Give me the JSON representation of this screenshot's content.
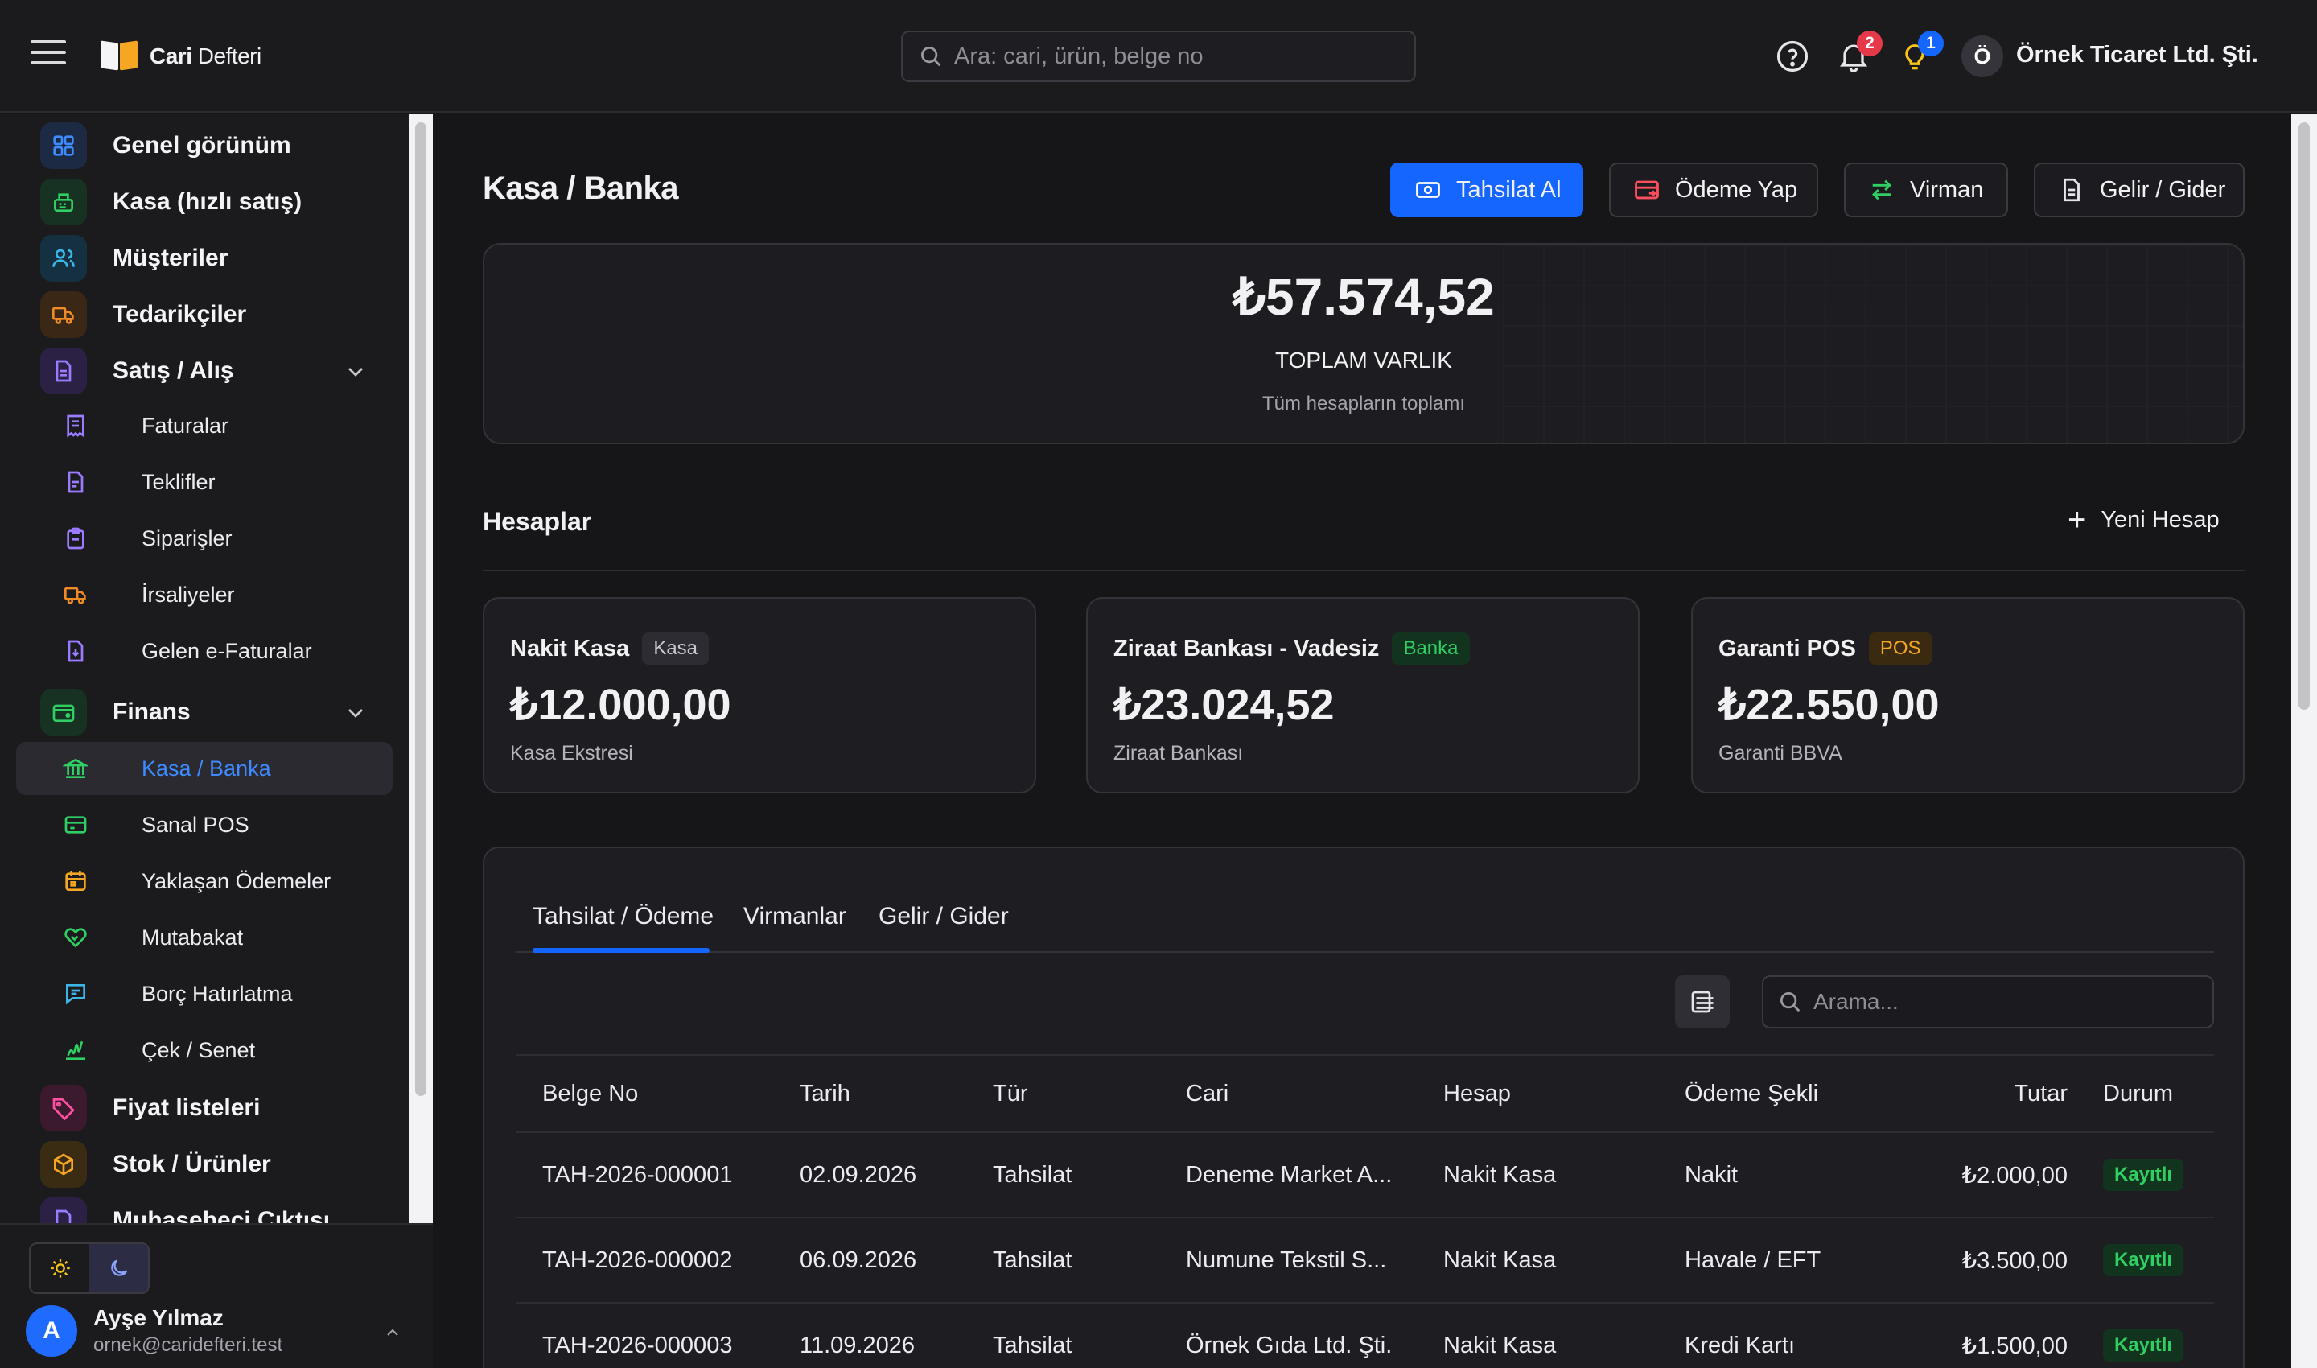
{
  "app": {
    "brand_bold": "Cari",
    "brand_rest": " Defteri"
  },
  "topbar": {
    "search_placeholder": "Ara: cari, ürün, belge no",
    "notifications_count": "2",
    "tips_count": "1",
    "company_initial": "Ö",
    "company_name": "Örnek Ticaret Ltd. Şti."
  },
  "sidebar": {
    "main": [
      {
        "label": "Genel görünüm",
        "icon": "grid-icon",
        "color": "#3d8bff"
      },
      {
        "label": "Kasa (hızlı satış)",
        "icon": "cash-register-icon",
        "color": "#2fcf63"
      },
      {
        "label": "Müşteriler",
        "icon": "users-icon",
        "color": "#3db5e8"
      },
      {
        "label": "Tedarikçiler",
        "icon": "truck-icon",
        "color": "#f08a24"
      },
      {
        "label": "Satış / Alış",
        "icon": "document-icon",
        "color": "#9b7bff"
      }
    ],
    "sales_sub": [
      {
        "label": "Faturalar",
        "icon": "receipt-icon",
        "color": "#9b7bff"
      },
      {
        "label": "Teklifler",
        "icon": "file-icon",
        "color": "#9b7bff"
      },
      {
        "label": "Siparişler",
        "icon": "clipboard-icon",
        "color": "#9b7bff"
      },
      {
        "label": "İrsaliyeler",
        "icon": "truck-icon",
        "color": "#f08a24"
      },
      {
        "label": "Gelen e-Faturalar",
        "icon": "file-download-icon",
        "color": "#9b7bff"
      }
    ],
    "finance": {
      "label": "Finans",
      "icon": "wallet-icon",
      "color": "#2fcf63"
    },
    "finance_sub": [
      {
        "label": "Kasa / Banka",
        "icon": "bank-icon",
        "color": "#2fcf63"
      },
      {
        "label": "Sanal POS",
        "icon": "credit-card-icon",
        "color": "#2fcf63"
      },
      {
        "label": "Yaklaşan Ödemeler",
        "icon": "calendar-icon",
        "color": "#f5a623"
      },
      {
        "label": "Mutabakat",
        "icon": "handshake-icon",
        "color": "#2fcf63"
      },
      {
        "label": "Borç Hatırlatma",
        "icon": "message-icon",
        "color": "#3db5e8"
      },
      {
        "label": "Çek / Senet",
        "icon": "check-icon",
        "color": "#2fcf63"
      }
    ],
    "bottom": [
      {
        "label": "Fiyat listeleri",
        "icon": "tag-icon",
        "color": "#ff4fa3"
      },
      {
        "label": "Stok / Ürünler",
        "icon": "box-icon",
        "color": "#f5a623"
      },
      {
        "label": "Muhasebeci Çıktısı",
        "icon": "file-icon",
        "color": "#9b7bff"
      }
    ],
    "user": {
      "initial": "A",
      "name": "Ayşe Yılmaz",
      "email": "ornek@caridefteri.test"
    }
  },
  "page": {
    "title": "Kasa / Banka",
    "actions": [
      {
        "label": "Tahsilat Al",
        "icon": "cash-icon"
      },
      {
        "label": "Ödeme Yap",
        "icon": "card-out-icon"
      },
      {
        "label": "Virman",
        "icon": "transfer-icon"
      },
      {
        "label": "Gelir / Gider",
        "icon": "document-icon"
      }
    ],
    "total": {
      "amount": "₺57.574,52",
      "label": "TOPLAM VARLIK",
      "sub": "Tüm hesapların toplamı"
    },
    "accounts_title": "Hesaplar",
    "new_account": "Yeni Hesap",
    "accounts": [
      {
        "name": "Nakit Kasa",
        "tag": "Kasa",
        "balance": "₺12.000,00",
        "sub": "Kasa Ekstresi",
        "tag_bg": "#2c2c32",
        "tag_fg": "#c8c8ce"
      },
      {
        "name": "Ziraat Bankası - Vadesiz",
        "tag": "Banka",
        "balance": "₺23.024,52",
        "sub": "Ziraat Bankası",
        "tag_bg": "#12331d",
        "tag_fg": "#2fcf63"
      },
      {
        "name": "Garanti POS",
        "tag": "POS",
        "balance": "₺22.550,00",
        "sub": "Garanti BBVA",
        "tag_bg": "#3a2a10",
        "tag_fg": "#f5a623"
      }
    ],
    "tabs": [
      "Tahsilat / Ödeme",
      "Virmanlar",
      "Gelir / Gider"
    ],
    "table_search_placeholder": "Arama...",
    "columns": [
      "Belge No",
      "Tarih",
      "Tür",
      "Cari",
      "Hesap",
      "Ödeme Şekli",
      "Tutar",
      "Durum"
    ],
    "rows": [
      [
        "TAH-2026-000001",
        "02.09.2026",
        "Tahsilat",
        "Deneme Market A...",
        "Nakit Kasa",
        "Nakit",
        "₺2.000,00",
        "Kayıtlı"
      ],
      [
        "TAH-2026-000002",
        "06.09.2026",
        "Tahsilat",
        "Numune Tekstil S...",
        "Nakit Kasa",
        "Havale / EFT",
        "₺3.500,00",
        "Kayıtlı"
      ],
      [
        "TAH-2026-000003",
        "11.09.2026",
        "Tahsilat",
        "Örnek Gıda Ltd. Şti.",
        "Nakit Kasa",
        "Kredi Kartı",
        "₺1.500,00",
        "Kayıtlı"
      ]
    ]
  }
}
